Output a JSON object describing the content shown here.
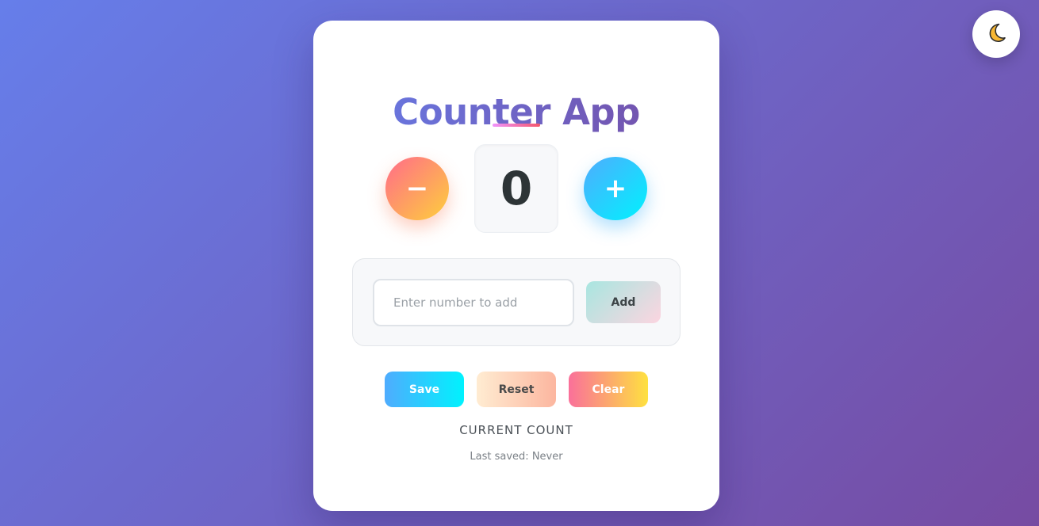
{
  "theme_toggle": {
    "icon": "moon-icon",
    "glyph": "🌙"
  },
  "app": {
    "title": "Counter App",
    "count": "0",
    "decrement_symbol": "−",
    "increment_symbol": "+"
  },
  "input_panel": {
    "placeholder": "Enter number to add",
    "value": "",
    "add_label": "Add"
  },
  "actions": {
    "save_label": "Save",
    "reset_label": "Reset",
    "clear_label": "Clear"
  },
  "status": {
    "count_label": "CURRENT COUNT",
    "last_saved": "Last saved: Never"
  },
  "colors": {
    "background_start": "#667eea",
    "background_end": "#764ba2",
    "decrement_start": "#ff6b8a",
    "decrement_end": "#fecf3c",
    "increment_start": "#4facfe",
    "increment_end": "#00f2fe",
    "count_text": "#2d3436"
  }
}
